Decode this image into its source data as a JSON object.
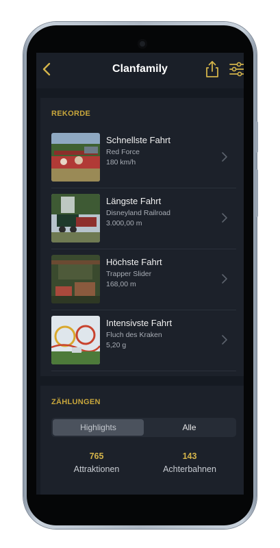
{
  "header": {
    "title": "Clanfamily",
    "back": "chevron-left-icon",
    "share": "share-icon",
    "filter": "sliders-icon"
  },
  "records": {
    "section_title": "REKORDE",
    "items": [
      {
        "title": "Schnellste Fahrt",
        "ride": "Red Force",
        "value": "180 km/h"
      },
      {
        "title": "Längste Fahrt",
        "ride": "Disneyland Railroad",
        "value": "3.000,00 m"
      },
      {
        "title": "Höchste Fahrt",
        "ride": "Trapper Slider",
        "value": "168,00 m"
      },
      {
        "title": "Intensivste Fahrt",
        "ride": "Fluch des Kraken",
        "value": "5,20 g"
      }
    ]
  },
  "counts": {
    "section_title": "ZÄHLUNGEN",
    "tabs": [
      "Highlights",
      "Alle"
    ],
    "selected_tab": "Highlights",
    "stats": [
      {
        "number": "765",
        "label": "Attraktionen"
      },
      {
        "number": "143",
        "label": "Achterbahnen"
      }
    ]
  },
  "colors": {
    "accent": "#d4b44a",
    "background": "#151a22",
    "card": "#1c212a"
  }
}
